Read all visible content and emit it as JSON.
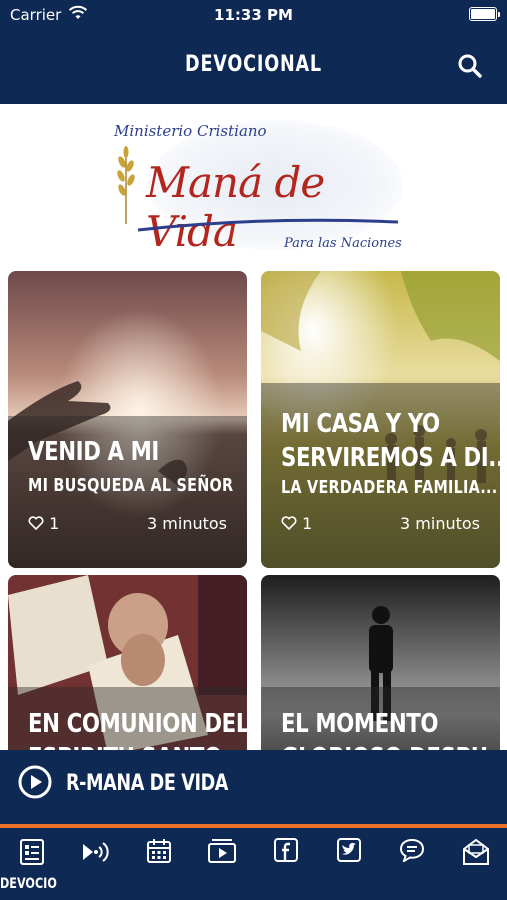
{
  "status_bar": {
    "carrier": "Carrier",
    "time": "11:33 PM"
  },
  "header": {
    "title": "DEVOCIONAL",
    "search_icon": "search-icon"
  },
  "logo": {
    "line1": "Ministerio Cristiano",
    "line2": "Maná de Vida",
    "line3": "Para las Naciones"
  },
  "cards": [
    {
      "title": "VENID A MI",
      "subtitle": "MI BUSQUEDA AL SEÑOR",
      "likes": "1",
      "duration": "3 minutos"
    },
    {
      "title": "MI CASA Y YO",
      "title2": "SERVIREMOS A DI...",
      "subtitle": "LA VERDADERA FAMILIA...",
      "likes": "1",
      "duration": "3 minutos"
    },
    {
      "title": "EN COMUNION DEL",
      "title2": "ESPIRITU SANTO"
    },
    {
      "title": "EL MOMENTO",
      "title2": "GLORIOSO DESPU..."
    }
  ],
  "player": {
    "name": "R-MANA DE VIDA",
    "icon": "play-circle-icon"
  },
  "tabbar": {
    "active_label": "DEVOCIO",
    "tabs": [
      "devotional-icon",
      "radio-icon",
      "calendar-icon",
      "video-icon",
      "facebook-icon",
      "twitter-icon",
      "chat-icon",
      "mail-icon"
    ]
  },
  "colors": {
    "navy": "#0e2a54",
    "accent": "#e8722a",
    "logo_red": "#b3261e",
    "logo_blue": "#2c3e8c"
  }
}
